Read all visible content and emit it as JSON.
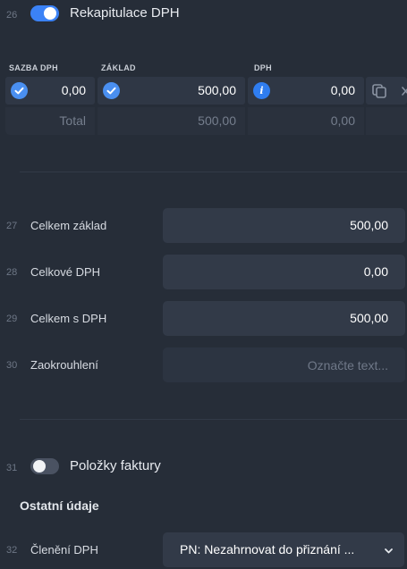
{
  "vat_recap": {
    "row_number": "26",
    "toggle_on": true,
    "title": "Rekapitulace DPH",
    "columns": {
      "rate": "SAZBA DPH",
      "base": "ZÁKLAD",
      "vat": "DPH"
    },
    "row": {
      "rate": "0,00",
      "base": "500,00",
      "vat": "0,00",
      "vat_icon": "i"
    },
    "total": {
      "label": "Total",
      "base": "500,00",
      "vat": "0,00"
    }
  },
  "fields": [
    {
      "row_number": "27",
      "label": "Celkem základ",
      "value": "500,00"
    },
    {
      "row_number": "28",
      "label": "Celkové DPH",
      "value": "0,00"
    },
    {
      "row_number": "29",
      "label": "Celkem s DPH",
      "value": "500,00"
    },
    {
      "row_number": "30",
      "label": "Zaokrouhlení",
      "value": "",
      "placeholder": "Označte text..."
    }
  ],
  "invoice_items": {
    "row_number": "31",
    "toggle_on": false,
    "title": "Položky faktury"
  },
  "other": {
    "heading": "Ostatní údaje",
    "vat_split": {
      "row_number": "32",
      "label": "Členění DPH",
      "value": "PN: Nezahrnovat do přiznání ..."
    }
  },
  "colors": {
    "background": "#262d38",
    "field": "#323a48",
    "accent": "#3b82f6"
  }
}
